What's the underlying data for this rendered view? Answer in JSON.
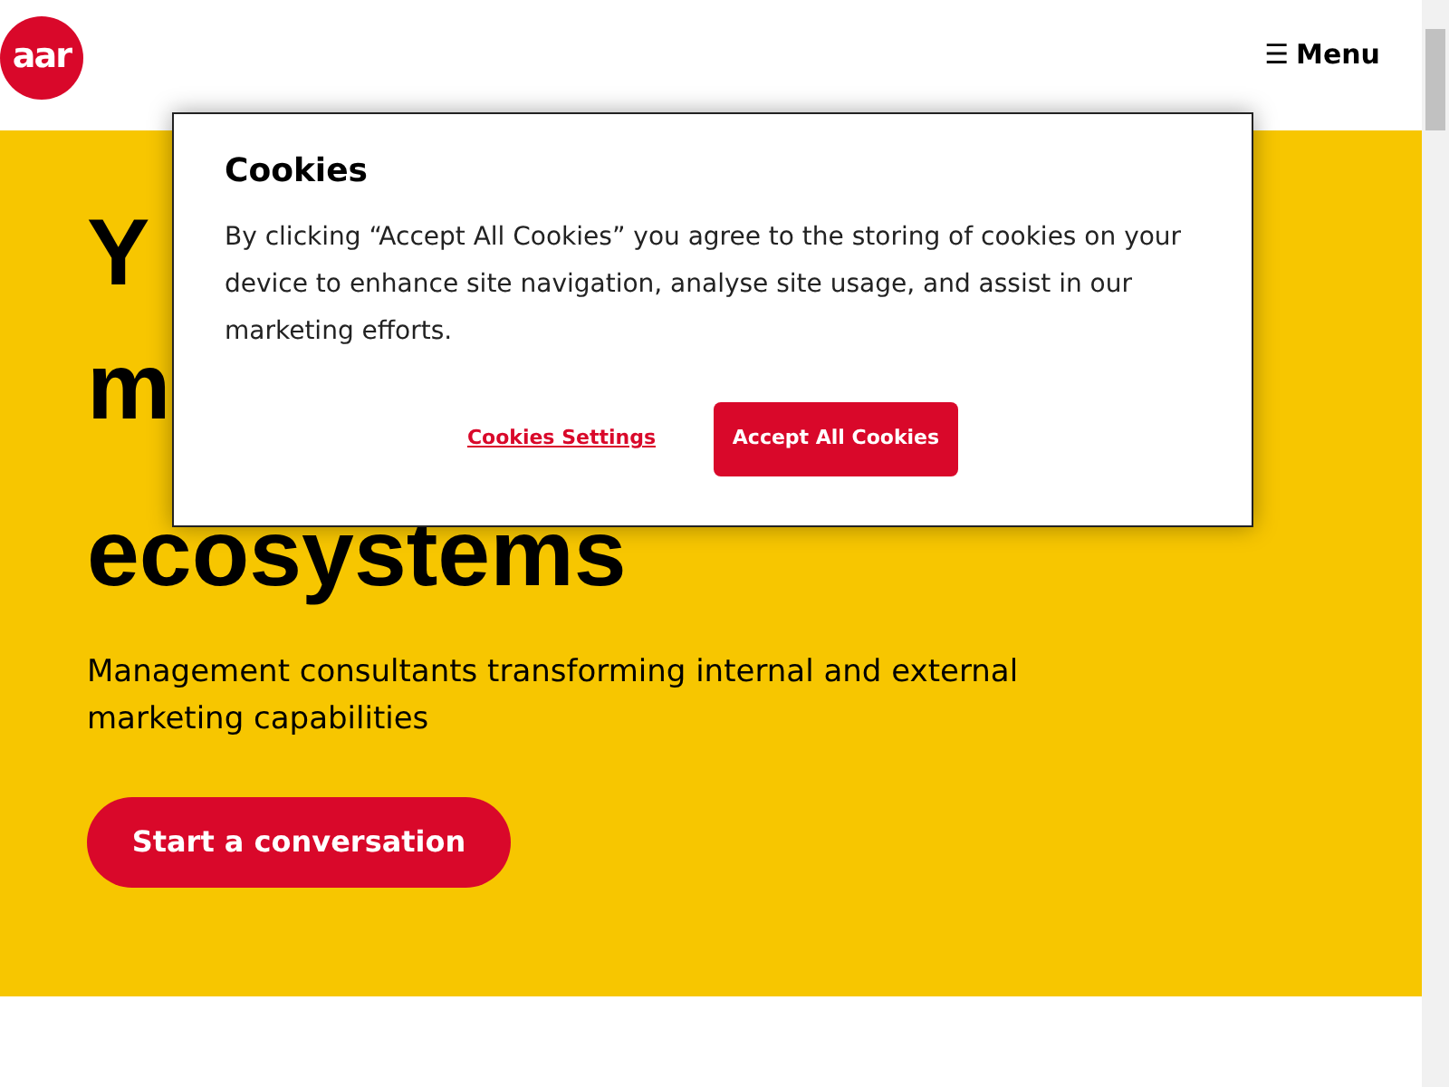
{
  "header": {
    "logo": "aar",
    "menu": {
      "icon": "☰",
      "label": "Menu"
    }
  },
  "hero": {
    "headline": [
      "Y",
      "m",
      "ecosystems"
    ],
    "subtitle": "Management consultants transforming internal and external marketing capabilities",
    "cta": "Start a conversation"
  },
  "cookie_dialog": {
    "title": "Cookies",
    "text": "By clicking “Accept All Cookies” you agree to the storing of cookies on your device to enhance site navigation, analyse site usage, and assist in our marketing efforts.",
    "settings_link": "Cookies Settings",
    "accept_button": "Accept All Cookies"
  }
}
